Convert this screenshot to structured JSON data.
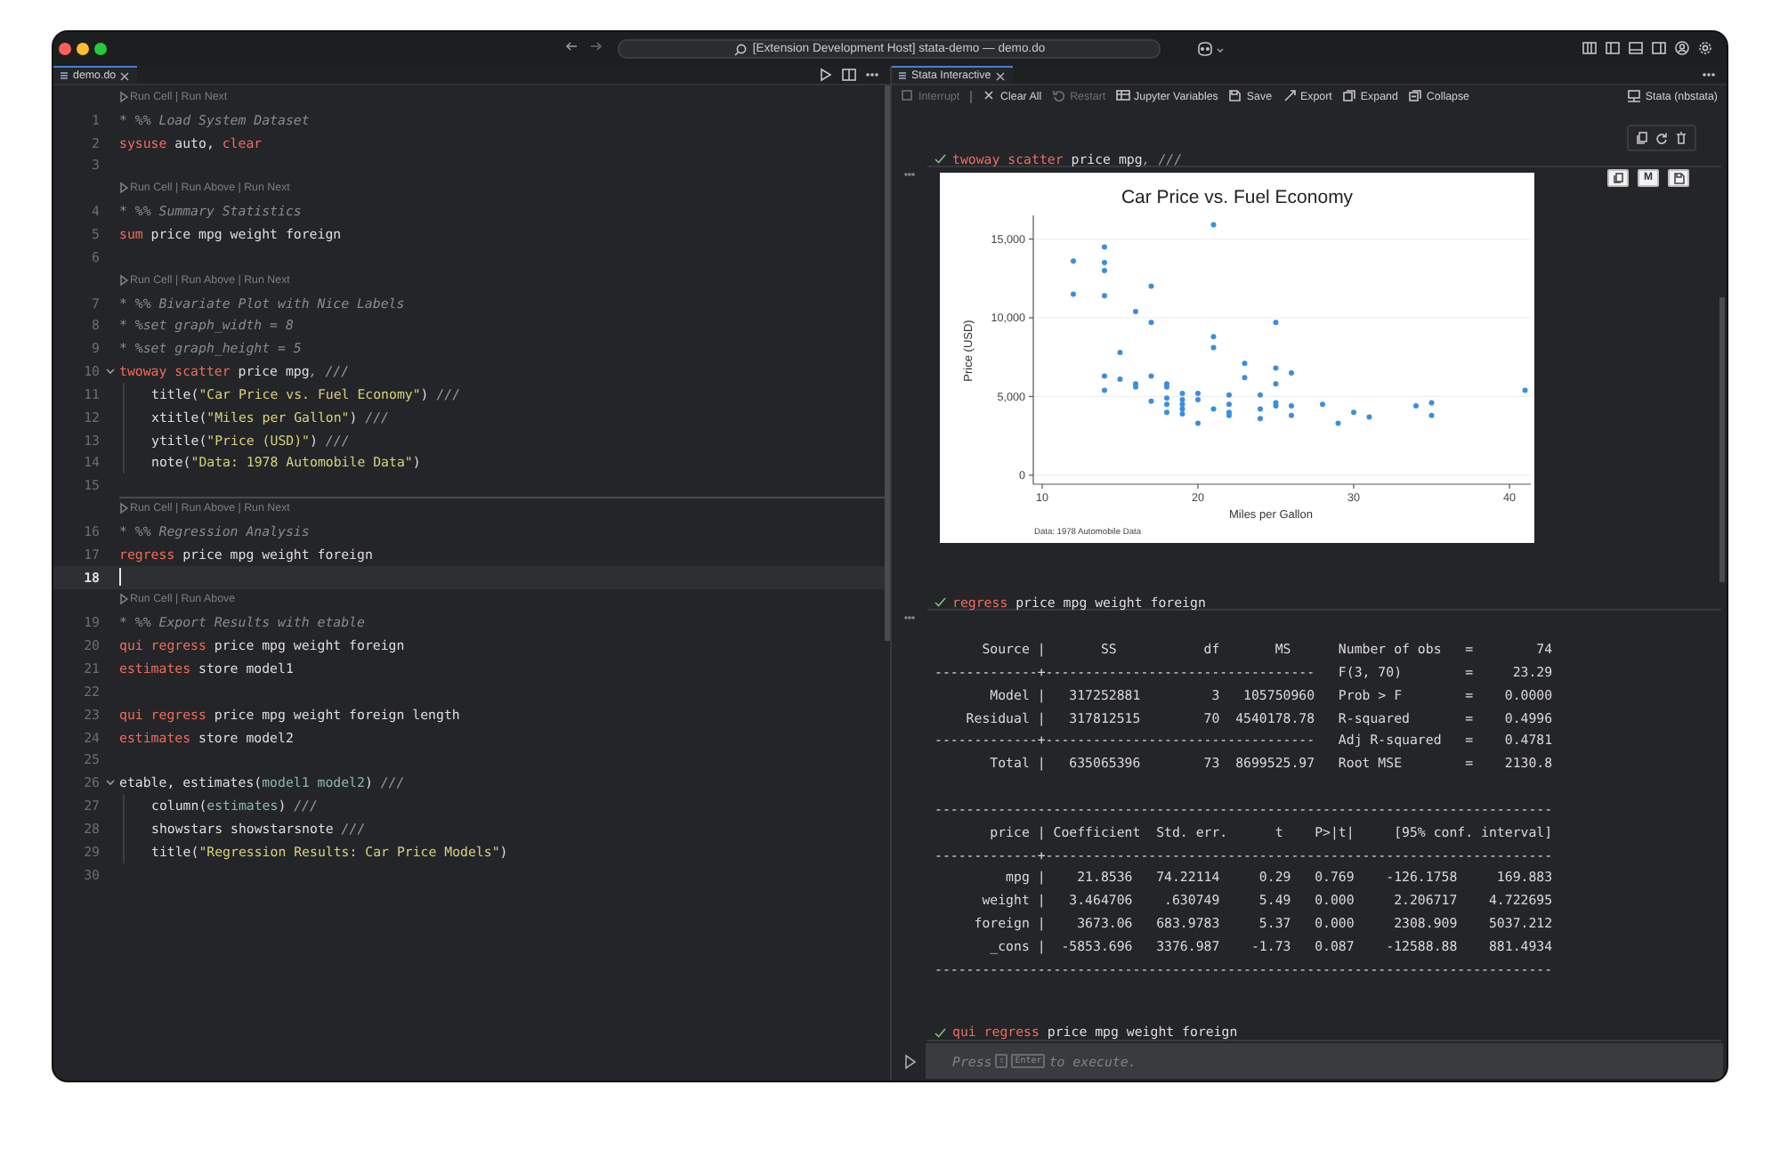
{
  "window": {
    "title": "[Extension Development Host] stata-demo — demo.do"
  },
  "editor": {
    "tab": {
      "label": "demo.do",
      "selected": true
    },
    "lines": [
      {
        "kind": "lens",
        "text": "Run Cell | Run Next",
        "active": false
      },
      {
        "kind": "code",
        "number": "1",
        "tokens": [
          {
            "kind": "comment",
            "text": "* %% Load System Dataset"
          }
        ]
      },
      {
        "kind": "code",
        "number": "2",
        "tokens": [
          {
            "kind": "kw",
            "text": "sysuse"
          },
          {
            "kind": "plain",
            "text": " auto, "
          },
          {
            "kind": "kw",
            "text": "clear"
          }
        ]
      },
      {
        "kind": "code",
        "number": "3"
      },
      {
        "kind": "lens",
        "text": "Run Cell | Run Above | Run Next",
        "active": false
      },
      {
        "kind": "code",
        "number": "4",
        "tokens": [
          {
            "kind": "comment",
            "text": "* %% Summary Statistics"
          }
        ]
      },
      {
        "kind": "code",
        "number": "5",
        "tokens": [
          {
            "kind": "kw",
            "text": "sum"
          },
          {
            "kind": "plain",
            "text": " price mpg weight foreign"
          }
        ]
      },
      {
        "kind": "code",
        "number": "6"
      },
      {
        "kind": "lens",
        "text": "Run Cell | Run Above | Run Next",
        "active": false
      },
      {
        "kind": "code",
        "number": "7",
        "tokens": [
          {
            "kind": "comment",
            "text": "* %% Bivariate Plot with Nice Labels"
          }
        ]
      },
      {
        "kind": "code",
        "number": "8",
        "tokens": [
          {
            "kind": "comment",
            "text": "* %set graph_width = 8"
          }
        ]
      },
      {
        "kind": "code",
        "number": "9",
        "tokens": [
          {
            "kind": "comment",
            "text": "* %set graph_height = 5"
          }
        ]
      },
      {
        "kind": "fold",
        "number": "10",
        "tokens": [
          {
            "kind": "kw",
            "text": "twoway scatter"
          },
          {
            "kind": "plain",
            "text": " price mpg"
          },
          {
            "kind": "cont",
            "text": ", ///"
          }
        ]
      },
      {
        "kind": "cont",
        "number": "11",
        "tokens": [
          {
            "kind": "plain",
            "text": "title("
          },
          {
            "kind": "str",
            "text": "\"Car Price vs. Fuel Economy\""
          },
          {
            "kind": "plain",
            "text": ") "
          },
          {
            "kind": "cont",
            "text": "///"
          }
        ]
      },
      {
        "kind": "cont",
        "number": "12",
        "tokens": [
          {
            "kind": "plain",
            "text": "xtitle("
          },
          {
            "kind": "str",
            "text": "\"Miles per Gallon\""
          },
          {
            "kind": "plain",
            "text": ") "
          },
          {
            "kind": "cont",
            "text": "///"
          }
        ]
      },
      {
        "kind": "cont",
        "number": "13",
        "tokens": [
          {
            "kind": "plain",
            "text": "ytitle("
          },
          {
            "kind": "str",
            "text": "\"Price (USD)\""
          },
          {
            "kind": "plain",
            "text": ") "
          },
          {
            "kind": "cont",
            "text": "///"
          }
        ]
      },
      {
        "kind": "cont",
        "number": "14",
        "tokens": [
          {
            "kind": "plain",
            "text": "note("
          },
          {
            "kind": "str",
            "text": "\"Data: 1978 Automobile Data\""
          },
          {
            "kind": "plain",
            "text": ")"
          }
        ]
      },
      {
        "kind": "code",
        "number": "15"
      },
      {
        "kind": "lens",
        "text": "Run Cell | Run Above | Run Next",
        "active": true
      },
      {
        "kind": "code",
        "number": "16",
        "tokens": [
          {
            "kind": "comment",
            "text": "* %% Regression Analysis"
          }
        ]
      },
      {
        "kind": "code",
        "number": "17",
        "tokens": [
          {
            "kind": "kw",
            "text": "regress"
          },
          {
            "kind": "plain",
            "text": " price mpg weight foreign"
          }
        ]
      },
      {
        "kind": "current",
        "number": "18"
      },
      {
        "kind": "lens",
        "text": "Run Cell | Run Above",
        "active": false
      },
      {
        "kind": "code",
        "number": "19",
        "tokens": [
          {
            "kind": "comment",
            "text": "* %% Export Results with etable"
          }
        ]
      },
      {
        "kind": "code",
        "number": "20",
        "tokens": [
          {
            "kind": "kw",
            "text": "qui regress"
          },
          {
            "kind": "plain",
            "text": " price mpg weight foreign"
          }
        ]
      },
      {
        "kind": "code",
        "number": "21",
        "tokens": [
          {
            "kind": "kw",
            "text": "estimates"
          },
          {
            "kind": "plain",
            "text": " store model1"
          }
        ]
      },
      {
        "kind": "code",
        "number": "22"
      },
      {
        "kind": "code",
        "number": "23",
        "tokens": [
          {
            "kind": "kw",
            "text": "qui regress"
          },
          {
            "kind": "plain",
            "text": " price mpg weight foreign length"
          }
        ]
      },
      {
        "kind": "code",
        "number": "24",
        "tokens": [
          {
            "kind": "kw",
            "text": "estimates"
          },
          {
            "kind": "plain",
            "text": " store model2"
          }
        ]
      },
      {
        "kind": "code",
        "number": "25"
      },
      {
        "kind": "fold",
        "number": "26",
        "tokens": [
          {
            "kind": "plain",
            "text": "etable, estimates("
          },
          {
            "kind": "fn",
            "text": "model1 model2"
          },
          {
            "kind": "plain",
            "text": ") "
          },
          {
            "kind": "cont",
            "text": "///"
          }
        ]
      },
      {
        "kind": "cont",
        "number": "27",
        "tokens": [
          {
            "kind": "plain",
            "text": "column("
          },
          {
            "kind": "fn",
            "text": "estimates"
          },
          {
            "kind": "plain",
            "text": ") "
          },
          {
            "kind": "cont",
            "text": "///"
          }
        ]
      },
      {
        "kind": "cont",
        "number": "28",
        "tokens": [
          {
            "kind": "plain",
            "text": "showstars showstarsnote "
          },
          {
            "kind": "cont",
            "text": "///"
          }
        ]
      },
      {
        "kind": "cont",
        "number": "29",
        "tokens": [
          {
            "kind": "plain",
            "text": "title("
          },
          {
            "kind": "str",
            "text": "\"Regression Results: Car Price Models\""
          },
          {
            "kind": "plain",
            "text": ")"
          }
        ]
      },
      {
        "kind": "code",
        "number": "30"
      }
    ]
  },
  "interactive": {
    "tab": {
      "label": "Stata Interactive",
      "selected": true
    },
    "toolbar": [
      {
        "label": "Interrupt",
        "disabled": true
      },
      {
        "label": "Clear All",
        "disabled": false
      },
      {
        "label": "Restart",
        "disabled": true
      },
      {
        "label": "Jupyter Variables",
        "disabled": false
      },
      {
        "label": "Save",
        "disabled": false
      },
      {
        "label": "Export",
        "disabled": false
      },
      {
        "label": "Expand",
        "disabled": false
      },
      {
        "label": "Collapse",
        "disabled": false
      }
    ],
    "kernel": "Stata (nbstata)",
    "cells": [
      {
        "selected": true,
        "succeeded": true,
        "command": [
          {
            "kind": "kw",
            "text": "twoway scatter"
          },
          {
            "kind": "plain",
            "text": " price mpg"
          },
          {
            "kind": "cont",
            "text": ", ///"
          }
        ],
        "output": {
          "kind": "chart",
          "actions": [
            {
              "kind": "copy"
            },
            {
              "kind": "label",
              "label": "M"
            },
            {
              "kind": "save"
            }
          ],
          "chart_data": {
            "type": "scatter",
            "title": "Car Price vs. Fuel Economy",
            "xlabel": "Miles per Gallon",
            "ylabel": "Price (USD)",
            "x": [
              12,
              12,
              14,
              14,
              14,
              14,
              14,
              14,
              15,
              15,
              16,
              16,
              16,
              17,
              17,
              17,
              17,
              18,
              18,
              18,
              18,
              18,
              19,
              19,
              19,
              19,
              19,
              20,
              20,
              20,
              21,
              21,
              21,
              21,
              22,
              22,
              22,
              22,
              23,
              23,
              24,
              24,
              24,
              25,
              25,
              25,
              25,
              25,
              26,
              26,
              26,
              28,
              29,
              30,
              31,
              34,
              35,
              35,
              41
            ],
            "values": [
              13600,
              11500,
              14500,
              13500,
              13000,
              11400,
              6300,
              5400,
              7800,
              6100,
              10400,
              5800,
              5600,
              12000,
              9700,
              6300,
              4700,
              5800,
              5600,
              4900,
              4500,
              4000,
              5200,
              4800,
              4500,
              4200,
              3900,
              5200,
              4800,
              3300,
              15900,
              8800,
              8100,
              4200,
              5100,
              4500,
              4000,
              3800,
              7100,
              6200,
              5100,
              4200,
              3600,
              9700,
              6800,
              5800,
              4600,
              4400,
              6500,
              4400,
              3800,
              4500,
              3300,
              4000,
              3700,
              4400,
              4600,
              3800,
              5400
            ],
            "xlim": [
              9.43,
              41.37
            ],
            "ylim": [
              -570,
              16500
            ],
            "grid": true,
            "xticks": [
              10,
              20,
              30,
              40
            ],
            "yticks": [
              {
                "value": 0,
                "label": "0"
              },
              {
                "value": 5000,
                "label": "5,000"
              },
              {
                "value": 10000,
                "label": "10,000"
              },
              {
                "value": 15000,
                "label": "15,000"
              }
            ],
            "annotations": [
              "Data: 1978 Automobile Data"
            ]
          }
        }
      },
      {
        "selected": false,
        "succeeded": true,
        "command": [
          {
            "kind": "kw",
            "text": "regress"
          },
          {
            "kind": "plain",
            "text": " price mpg weight foreign"
          }
        ],
        "output": {
          "kind": "text",
          "blocks": [
            [
              "      Source |       SS           df       MS      Number of obs   =        74",
              "-------------+----------------------------------   F(3, 70)        =     23.29",
              "       Model |   317252881         3   105750960   Prob > F        =    0.0000",
              "    Residual |   317812515        70  4540178.78   R-squared       =    0.4996",
              "-------------+----------------------------------   Adj R-squared   =    0.4781",
              "       Total |   635065396        73  8699525.97   Root MSE        =    2130.8"
            ],
            [
              "------------------------------------------------------------------------------",
              "       price | Coefficient  Std. err.      t    P>|t|     [95% conf. interval]",
              "-------------+----------------------------------------------------------------",
              "         mpg |    21.8536   74.22114     0.29   0.769    -126.1758     169.883",
              "      weight |   3.464706    .630749     5.49   0.000     2.206717    4.722695",
              "     foreign |    3673.06   683.9783     5.37   0.000     2308.909    5037.212",
              "       _cons |  -5853.696   3376.987    -1.73   0.087    -12588.88    881.4934",
              "------------------------------------------------------------------------------"
            ]
          ]
        }
      },
      {
        "selected": false,
        "succeeded": true,
        "command": [
          {
            "kind": "kw",
            "text": "qui regress"
          },
          {
            "kind": "plain",
            "text": " price mpg weight foreign"
          }
        ]
      }
    ],
    "input": {
      "hint": [
        {
          "kind": "text",
          "text": "Press"
        },
        {
          "kind": "key",
          "text": "⇧"
        },
        {
          "kind": "key",
          "text": "Enter"
        },
        {
          "kind": "text",
          "text": "to execute."
        }
      ]
    }
  }
}
